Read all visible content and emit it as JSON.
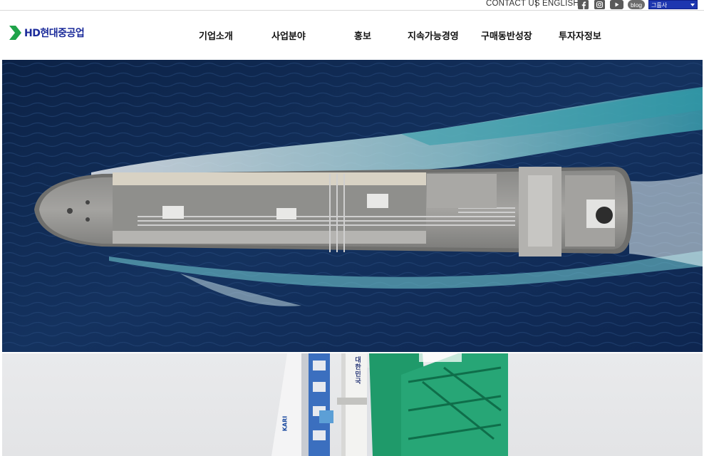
{
  "utility_bar": {
    "contact_label": "CONTACT US",
    "separator": "|",
    "english_label": "ENGLISH",
    "sns": [
      {
        "name": "facebook-icon",
        "glyph": "f"
      },
      {
        "name": "instagram-icon",
        "glyph": ""
      },
      {
        "name": "youtube-icon",
        "glyph": ""
      },
      {
        "name": "blog-icon",
        "glyph": "blog"
      }
    ],
    "group_select": {
      "selected": "그룹사"
    }
  },
  "header": {
    "logo_text": "HD현대중공업",
    "nav": [
      "기업소개",
      "사업분야",
      "홍보",
      "지속가능경영",
      "구매동반성장",
      "투자자정보"
    ]
  },
  "hero": {
    "rocket_label_korean": "대한민국",
    "rocket_label_kari": "KARI"
  },
  "colors": {
    "brand_green": "#1fa34a",
    "brand_navy": "#1a2a9a",
    "group_select_bg": "#1d36b0",
    "sea_dark": "#0f2750",
    "sea_mid": "#1b3d6e"
  }
}
